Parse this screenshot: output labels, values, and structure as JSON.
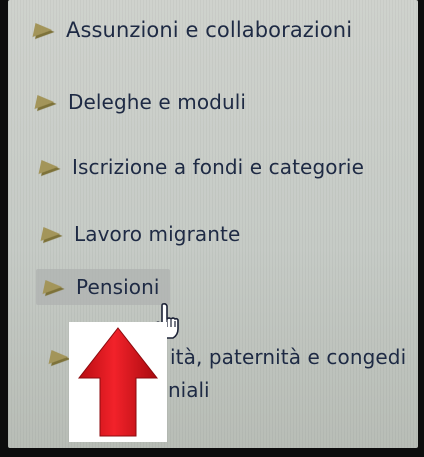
{
  "menu": {
    "items": [
      {
        "label": "Assunzioni e collaborazioni",
        "icon": "tag-icon"
      },
      {
        "label": "Deleghe e moduli",
        "icon": "tag-icon"
      },
      {
        "label": "Iscrizione a fondi e categorie",
        "icon": "tag-icon"
      },
      {
        "label": "Lavoro migrante",
        "icon": "tag-icon"
      },
      {
        "label": "Pensioni",
        "icon": "tag-icon"
      },
      {
        "label": "ità, paternità e congedi",
        "icon": "tag-icon"
      },
      {
        "label": "niali"
      }
    ]
  },
  "overlay": {
    "arrow_icon": "up-arrow-icon",
    "arrow_color": "#e8121a",
    "cursor_icon": "pointer-hand-icon"
  },
  "colors": {
    "text": "#1e2a44",
    "tag": "#a3955a",
    "background": "#c9cdc8"
  }
}
